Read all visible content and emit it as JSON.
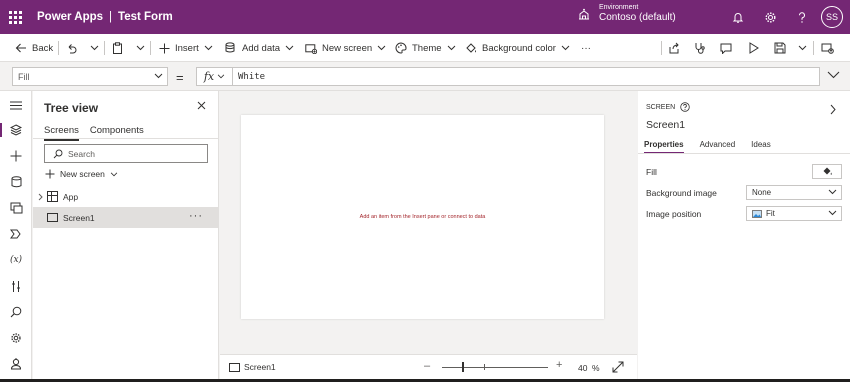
{
  "header": {
    "app_name": "Power Apps",
    "separator": "|",
    "app_title": "Test Form",
    "environment_label": "Environment",
    "environment_name": "Contoso (default)",
    "user_initials": "SS"
  },
  "command_bar": {
    "back": "Back",
    "insert": "Insert",
    "add_data": "Add data",
    "new_screen": "New screen",
    "theme": "Theme",
    "background_color": "Background color",
    "more": "···"
  },
  "formula_bar": {
    "property": "Fill",
    "equals": "=",
    "fx": "fx",
    "formula": "White"
  },
  "left_rail": {
    "variables": "(x)"
  },
  "tree_view": {
    "title": "Tree view",
    "tabs": [
      "Screens",
      "Components"
    ],
    "search_placeholder": "Search",
    "new_screen": "New screen",
    "items": [
      {
        "label": "App"
      },
      {
        "label": "Screen1",
        "more": "···"
      }
    ]
  },
  "canvas": {
    "hint": "Add an item from the Insert pane or connect to data",
    "footer_screen": "Screen1",
    "zoom_minus": "–",
    "zoom_plus": "+",
    "zoom_value": "40",
    "zoom_unit": "%",
    "zoom_fraction": 0.4
  },
  "properties_pane": {
    "section_label": "SCREEN",
    "screen_name": "Screen1",
    "tabs": [
      "Properties",
      "Advanced",
      "Ideas"
    ],
    "rows": [
      {
        "label": "Fill",
        "value": ""
      },
      {
        "label": "Background image",
        "value": "None"
      },
      {
        "label": "Image position",
        "value": "Fit"
      }
    ]
  },
  "colors": {
    "brand": "#742774",
    "hint_text": "#a4262c",
    "canvas_bg": "#f3f2f1",
    "fill_color": "#ffffff"
  }
}
